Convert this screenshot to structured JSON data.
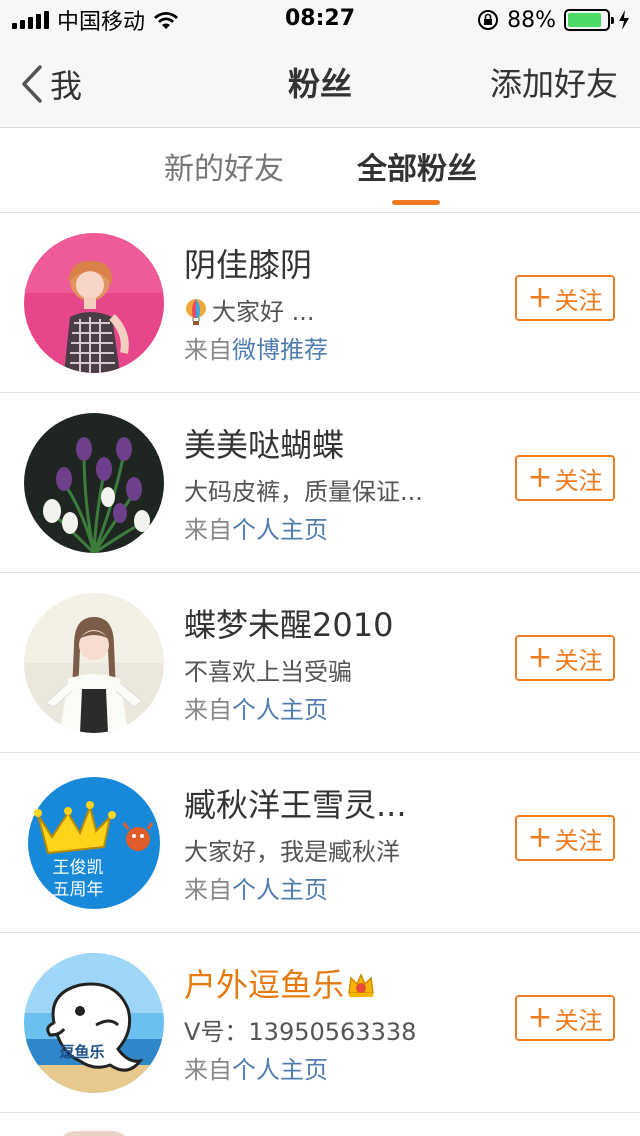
{
  "status_bar": {
    "carrier": "中国移动",
    "time": "08:27",
    "battery_percent": "88%",
    "battery_level": 0.88
  },
  "nav": {
    "back_label": "我",
    "title": "粉丝",
    "right_action": "添加好友"
  },
  "tabs": [
    {
      "label": "新的好友",
      "active": false
    },
    {
      "label": "全部粉丝",
      "active": true
    }
  ],
  "colors": {
    "accent": "#f07b1f",
    "link": "#507daf",
    "vip_name": "#e6790f"
  },
  "fans": [
    {
      "name": "阴佳膝阴",
      "desc": "大家好 ...",
      "desc_icon": "balloon-icon",
      "source_prefix": "来自",
      "source": "微博推荐",
      "follow_label": "关注",
      "avatar": "pink-girl-avatar"
    },
    {
      "name": "美美哒蝴蝶",
      "desc": "大码皮裤，质量保证...",
      "source_prefix": "来自",
      "source": "个人主页",
      "follow_label": "关注",
      "avatar": "tulips-avatar"
    },
    {
      "name": "蝶梦未醒2010",
      "desc": "不喜欢上当受骗",
      "source_prefix": "来自",
      "source": "个人主页",
      "follow_label": "关注",
      "avatar": "girl-braids-avatar"
    },
    {
      "name": "臧秋洋王雪灵...",
      "desc": "大家好，我是臧秋洋",
      "source_prefix": "来自",
      "source": "个人主页",
      "follow_label": "关注",
      "avatar": "crown-blue-avatar",
      "avatar_text_line1": "王俊凯",
      "avatar_text_line2": "五周年"
    },
    {
      "name": "户外逗鱼乐",
      "name_icon": "vip-crown-icon",
      "desc": "V号：13950563338",
      "source_prefix": "来自",
      "source": "个人主页",
      "follow_label": "关注",
      "avatar": "dolphin-avatar",
      "avatar_text": "逗鱼乐"
    }
  ]
}
